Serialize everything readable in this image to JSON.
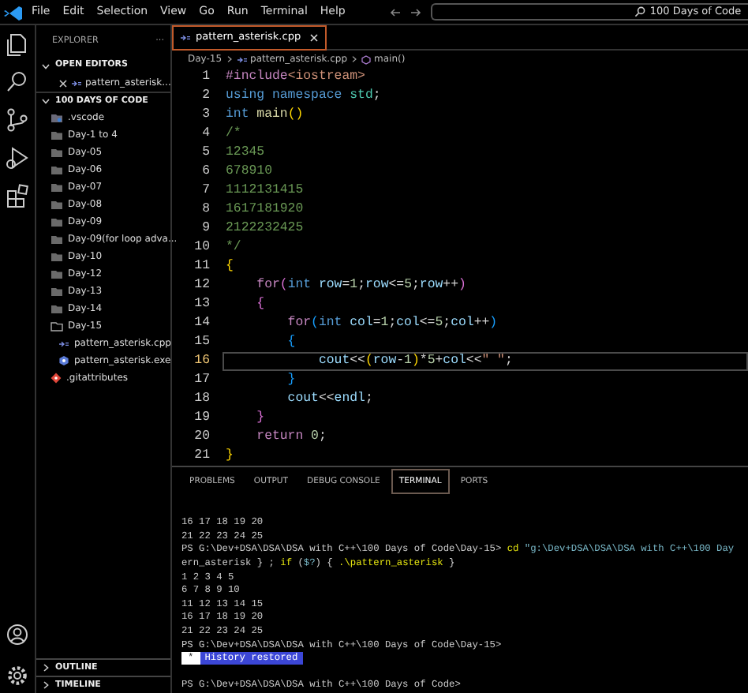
{
  "menu": [
    "File",
    "Edit",
    "Selection",
    "View",
    "Go",
    "Run",
    "Terminal",
    "Help"
  ],
  "command_center": "100 Days of Code",
  "sidebar": {
    "title": "EXPLORER",
    "more": "···",
    "open_editors": {
      "label": "OPEN EDITORS",
      "expanded": true,
      "files": [
        {
          "name": "pattern_asterisk...",
          "kind": "cpp"
        }
      ]
    },
    "folder": {
      "label": "100 DAYS OF CODE",
      "expanded": true,
      "children": [
        {
          "name": ".vscode",
          "kind": "settings-folder"
        },
        {
          "name": "Day-1 to 4",
          "kind": "folder"
        },
        {
          "name": "Day-05",
          "kind": "folder"
        },
        {
          "name": "Day-06",
          "kind": "folder"
        },
        {
          "name": "Day-07",
          "kind": "folder"
        },
        {
          "name": "Day-08",
          "kind": "folder"
        },
        {
          "name": "Day-09",
          "kind": "folder"
        },
        {
          "name": "Day-09(for loop adva...",
          "kind": "folder"
        },
        {
          "name": "Day-10",
          "kind": "folder"
        },
        {
          "name": "Day-12",
          "kind": "folder"
        },
        {
          "name": "Day-13",
          "kind": "folder"
        },
        {
          "name": "Day-14",
          "kind": "folder"
        },
        {
          "name": "Day-15",
          "kind": "folder",
          "expanded": true,
          "children": [
            {
              "name": "pattern_asterisk.cpp",
              "kind": "cpp"
            },
            {
              "name": "pattern_asterisk.exe",
              "kind": "exe"
            }
          ]
        },
        {
          "name": ".gitattributes",
          "kind": "git"
        }
      ]
    },
    "sections": [
      {
        "label": "OUTLINE",
        "expanded": false
      },
      {
        "label": "TIMELINE",
        "expanded": false
      }
    ]
  },
  "editor": {
    "tabs": [
      {
        "label": "pattern_asterisk.cpp",
        "selected": true
      }
    ],
    "breadcrumb": [
      "Day-15",
      "pattern_asterisk.cpp",
      "main()"
    ],
    "lines": [
      {
        "number": "1",
        "current": false,
        "tokens": [
          {
            "kind": "ctl",
            "text": "#include"
          },
          {
            "kind": "str",
            "text": "<iostream>"
          }
        ]
      },
      {
        "number": "2",
        "current": false,
        "tokens": [
          {
            "kind": "kw",
            "text": "using "
          },
          {
            "kind": "kw",
            "text": "namespace "
          },
          {
            "kind": "type",
            "text": "std"
          },
          {
            "kind": "plain",
            "text": ";"
          }
        ]
      },
      {
        "number": "3",
        "current": false,
        "tokens": [
          {
            "kind": "kw",
            "text": "int "
          },
          {
            "kind": "fn",
            "text": "main"
          },
          {
            "kind": "br1",
            "text": "()"
          }
        ]
      },
      {
        "number": "4",
        "current": false,
        "tokens": [
          {
            "kind": "cm",
            "text": "/*"
          }
        ]
      },
      {
        "number": "5",
        "current": false,
        "tokens": [
          {
            "kind": "cm",
            "text": "12345"
          }
        ]
      },
      {
        "number": "6",
        "current": false,
        "tokens": [
          {
            "kind": "cm",
            "text": "678910"
          }
        ]
      },
      {
        "number": "7",
        "current": false,
        "tokens": [
          {
            "kind": "cm",
            "text": "1112131415"
          }
        ]
      },
      {
        "number": "8",
        "current": false,
        "tokens": [
          {
            "kind": "cm",
            "text": "1617181920"
          }
        ]
      },
      {
        "number": "9",
        "current": false,
        "tokens": [
          {
            "kind": "cm",
            "text": "2122232425"
          }
        ]
      },
      {
        "number": "10",
        "current": false,
        "tokens": [
          {
            "kind": "cm",
            "text": "*/"
          }
        ]
      },
      {
        "number": "11",
        "current": false,
        "tokens": [
          {
            "kind": "br1",
            "text": "{"
          }
        ]
      },
      {
        "number": "12",
        "current": false,
        "tokens": [
          {
            "kind": "ctl",
            "text": "    for"
          },
          {
            "kind": "br2",
            "text": "("
          },
          {
            "kind": "kw",
            "text": "int "
          },
          {
            "kind": "var",
            "text": "row"
          },
          {
            "kind": "plain",
            "text": "="
          },
          {
            "kind": "num",
            "text": "1"
          },
          {
            "kind": "plain",
            "text": ";"
          },
          {
            "kind": "var",
            "text": "row"
          },
          {
            "kind": "plain",
            "text": "<="
          },
          {
            "kind": "num",
            "text": "5"
          },
          {
            "kind": "plain",
            "text": ";"
          },
          {
            "kind": "var",
            "text": "row"
          },
          {
            "kind": "plain",
            "text": "++"
          },
          {
            "kind": "br2",
            "text": ")"
          }
        ]
      },
      {
        "number": "13",
        "current": false,
        "tokens": [
          {
            "kind": "br2",
            "text": "    {"
          }
        ]
      },
      {
        "number": "14",
        "current": false,
        "tokens": [
          {
            "kind": "ctl",
            "text": "        for"
          },
          {
            "kind": "br3",
            "text": "("
          },
          {
            "kind": "kw",
            "text": "int "
          },
          {
            "kind": "var",
            "text": "col"
          },
          {
            "kind": "plain",
            "text": "="
          },
          {
            "kind": "num",
            "text": "1"
          },
          {
            "kind": "plain",
            "text": ";"
          },
          {
            "kind": "var",
            "text": "col"
          },
          {
            "kind": "plain",
            "text": "<="
          },
          {
            "kind": "num",
            "text": "5"
          },
          {
            "kind": "plain",
            "text": ";"
          },
          {
            "kind": "var",
            "text": "col"
          },
          {
            "kind": "plain",
            "text": "++"
          },
          {
            "kind": "br3",
            "text": ")"
          }
        ]
      },
      {
        "number": "15",
        "current": false,
        "tokens": [
          {
            "kind": "br3",
            "text": "        {"
          }
        ]
      },
      {
        "number": "16",
        "current": true,
        "tokens": [
          {
            "kind": "var",
            "text": "            cout"
          },
          {
            "kind": "plain",
            "text": "<<"
          },
          {
            "kind": "br1",
            "text": "("
          },
          {
            "kind": "var",
            "text": "row"
          },
          {
            "kind": "plain",
            "text": "-"
          },
          {
            "kind": "num",
            "text": "1"
          },
          {
            "kind": "br1",
            "text": ")"
          },
          {
            "kind": "plain",
            "text": "*"
          },
          {
            "kind": "num",
            "text": "5"
          },
          {
            "kind": "plain",
            "text": "+"
          },
          {
            "kind": "var",
            "text": "col"
          },
          {
            "kind": "plain",
            "text": "<<"
          },
          {
            "kind": "str",
            "text": "\" \""
          },
          {
            "kind": "plain",
            "text": ";"
          }
        ]
      },
      {
        "number": "17",
        "current": false,
        "tokens": [
          {
            "kind": "br3",
            "text": "        }"
          }
        ]
      },
      {
        "number": "18",
        "current": false,
        "tokens": [
          {
            "kind": "var",
            "text": "        cout"
          },
          {
            "kind": "plain",
            "text": "<<"
          },
          {
            "kind": "var",
            "text": "endl"
          },
          {
            "kind": "plain",
            "text": ";"
          }
        ]
      },
      {
        "number": "19",
        "current": false,
        "tokens": [
          {
            "kind": "br2",
            "text": "    }"
          }
        ]
      },
      {
        "number": "20",
        "current": false,
        "tokens": [
          {
            "kind": "ctl",
            "text": "    return "
          },
          {
            "kind": "num",
            "text": "0"
          },
          {
            "kind": "plain",
            "text": ";"
          }
        ]
      },
      {
        "number": "21",
        "current": false,
        "tokens": [
          {
            "kind": "br1",
            "text": "}"
          }
        ]
      }
    ]
  },
  "panel": {
    "tabs": [
      {
        "label": "PROBLEMS",
        "selected": false
      },
      {
        "label": "OUTPUT",
        "selected": false
      },
      {
        "label": "DEBUG CONSOLE",
        "selected": false
      },
      {
        "label": "TERMINAL",
        "selected": true
      },
      {
        "label": "PORTS",
        "selected": false
      }
    ],
    "terminal": [
      {
        "kind": "text",
        "tokens": [
          {
            "kind": "plain",
            "text": "16 17 18 19 20"
          }
        ]
      },
      {
        "kind": "text",
        "tokens": [
          {
            "kind": "plain",
            "text": "21 22 23 24 25"
          }
        ]
      },
      {
        "kind": "text",
        "tokens": [
          {
            "kind": "plain",
            "text": "PS G:\\Dev+DSA\\DSA\\DSA with C++\\100 Days of Code\\Day-15> "
          },
          {
            "kind": "cmd",
            "text": "cd "
          },
          {
            "kind": "arg",
            "text": "\"g:\\Dev+DSA\\DSA\\DSA with C++\\100 Day"
          }
        ]
      },
      {
        "kind": "text",
        "tokens": [
          {
            "kind": "plain",
            "text": "ern_asterisk } ; "
          },
          {
            "kind": "cmd",
            "text": "if"
          },
          {
            "kind": "plain",
            "text": " ("
          },
          {
            "kind": "arg",
            "text": "$?"
          },
          {
            "kind": "plain",
            "text": ") { "
          },
          {
            "kind": "cmd",
            "text": ".\\pattern_asterisk"
          },
          {
            "kind": "plain",
            "text": " }"
          }
        ]
      },
      {
        "kind": "text",
        "tokens": [
          {
            "kind": "plain",
            "text": "1 2 3 4 5"
          }
        ]
      },
      {
        "kind": "text",
        "tokens": [
          {
            "kind": "plain",
            "text": "6 7 8 9 10"
          }
        ]
      },
      {
        "kind": "text",
        "tokens": [
          {
            "kind": "plain",
            "text": "11 12 13 14 15"
          }
        ]
      },
      {
        "kind": "text",
        "tokens": [
          {
            "kind": "plain",
            "text": "16 17 18 19 20"
          }
        ]
      },
      {
        "kind": "text",
        "tokens": [
          {
            "kind": "plain",
            "text": "21 22 23 24 25"
          }
        ]
      },
      {
        "kind": "text",
        "tokens": [
          {
            "kind": "plain",
            "text": "PS G:\\Dev+DSA\\DSA\\DSA with C++\\100 Days of Code\\Day-15>"
          }
        ]
      },
      {
        "kind": "notice",
        "mark": "*",
        "text": "History restored"
      },
      {
        "kind": "blank"
      },
      {
        "kind": "text",
        "tokens": [
          {
            "kind": "plain",
            "text": "PS G:\\Dev+DSA\\DSA\\DSA with C++\\100 Days of Code>"
          }
        ]
      }
    ]
  }
}
